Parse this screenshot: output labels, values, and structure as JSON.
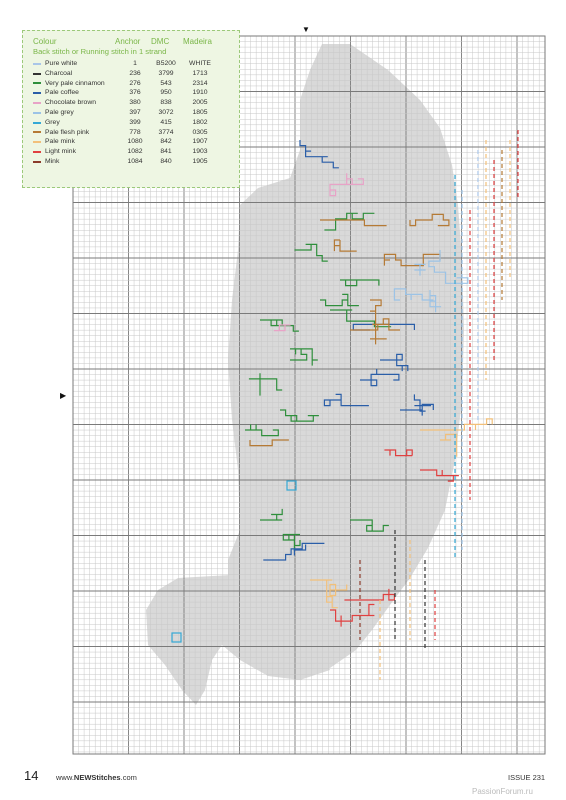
{
  "key": {
    "headers": [
      "Colour",
      "Anchor",
      "DMC",
      "Madeira"
    ],
    "subtitle": "Back stitch or Running stitch in 1 strand",
    "threads": [
      {
        "name": "Pure white",
        "anchor": "1",
        "dmc": "B5200",
        "madeira": "WHITE",
        "color": "#a9c6e8"
      },
      {
        "name": "Charcoal",
        "anchor": "236",
        "dmc": "3799",
        "madeira": "1713",
        "color": "#333333"
      },
      {
        "name": "Very pale cinnamon",
        "anchor": "276",
        "dmc": "543",
        "madeira": "2314",
        "color": "#2f8f3c"
      },
      {
        "name": "Pale coffee",
        "anchor": "376",
        "dmc": "950",
        "madeira": "1910",
        "color": "#2a5ea8"
      },
      {
        "name": "Chocolate brown",
        "anchor": "380",
        "dmc": "838",
        "madeira": "2005",
        "color": "#e8a3c7"
      },
      {
        "name": "Pale grey",
        "anchor": "397",
        "dmc": "3072",
        "madeira": "1805",
        "color": "#9cc3e6"
      },
      {
        "name": "Grey",
        "anchor": "399",
        "dmc": "415",
        "madeira": "1802",
        "color": "#35a9d6"
      },
      {
        "name": "Pale flesh pink",
        "anchor": "778",
        "dmc": "3774",
        "madeira": "0305",
        "color": "#b57a35"
      },
      {
        "name": "Pale mink",
        "anchor": "1080",
        "dmc": "842",
        "madeira": "1907",
        "color": "#f2c07a"
      },
      {
        "name": "Light mink",
        "anchor": "1082",
        "dmc": "841",
        "madeira": "1903",
        "color": "#e04040"
      },
      {
        "name": "Mink",
        "anchor": "1084",
        "dmc": "840",
        "madeira": "1905",
        "color": "#8b3b2b"
      }
    ]
  },
  "markers": {
    "top": "▼",
    "left": "▶"
  },
  "footer": {
    "page_number": "14",
    "web_prefix": "www.",
    "web_brand": "NEWStitches",
    "web_suffix": ".com",
    "issue": "ISSUE 231",
    "watermark": "PassionForum.ru"
  },
  "colors": {
    "grid_minor": "#c8c8c8",
    "grid_major": "#7a7a7a",
    "fill": "#d9d9d9",
    "key_bg": "#eef6e3",
    "key_accent": "#7ab648"
  }
}
